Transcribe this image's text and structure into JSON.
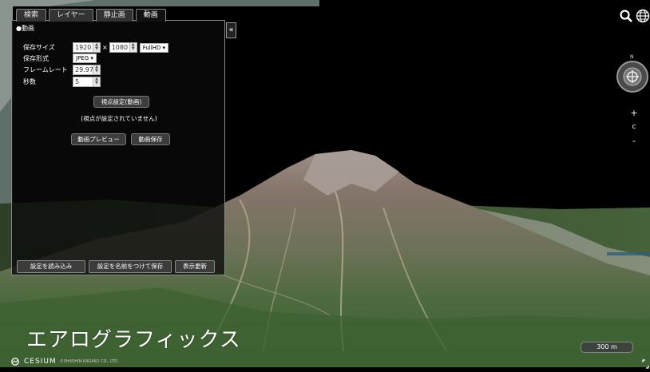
{
  "tabs": [
    {
      "label": "検索"
    },
    {
      "label": "レイヤー"
    },
    {
      "label": "静止画"
    },
    {
      "label": "動画"
    }
  ],
  "panel": {
    "collapse_label": "«",
    "section_title": "●動画",
    "size_label": "保存サイズ",
    "width_value": "1920",
    "times": "×",
    "height_value": "1080",
    "size_preset": "FullHD ▾",
    "format_label": "保存形式",
    "format_value": "JPEG ▾",
    "framerate_label": "フレームレート",
    "framerate_value": "29.97",
    "seconds_label": "秒数",
    "seconds_value": "5",
    "viewpoint_button": "視点設定(動画)",
    "viewpoint_note": "(視点が設定されていません)",
    "preview_button": "動画プレビュー",
    "save_button": "動画保存",
    "load_settings_button": "設定を読み込み",
    "save_settings_button": "設定を名前をつけて保存",
    "refresh_button": "表示更新"
  },
  "controls": {
    "zoom_in": "+",
    "reset": "c",
    "zoom_out": "-"
  },
  "overlay": {
    "caption": "エアログラフィックス"
  },
  "scale": {
    "label": "300 m"
  },
  "credits": {
    "logo": "CESIUM",
    "copyright": "©SHASHIN KAGAKU CO., LTD."
  }
}
